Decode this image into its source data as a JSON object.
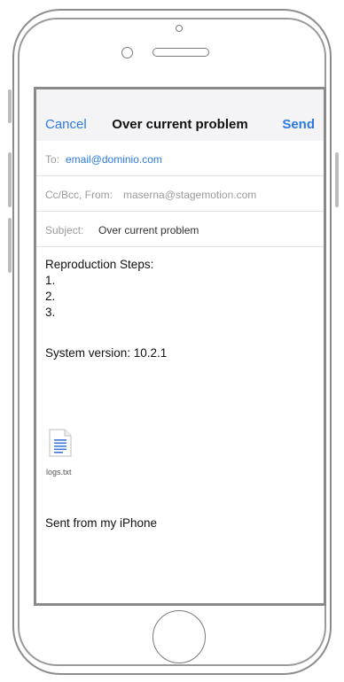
{
  "nav": {
    "cancel_label": "Cancel",
    "title": "Over current problem",
    "send_label": "Send"
  },
  "fields": {
    "to_label": "To:",
    "to_value": "email@dominio.com",
    "ccbcc_label": "Cc/Bcc, From:",
    "from_value": "maserna@stagemotion.com",
    "subject_label": "Subject:",
    "subject_value": "Over current problem"
  },
  "body": {
    "repro_title": "Reproduction Steps:",
    "steps": [
      "1.",
      "2.",
      "3."
    ],
    "system_version": "System version: 10.2.1",
    "attachment_name": "logs.txt",
    "signature": "Sent from my iPhone"
  },
  "colors": {
    "accent": "#2a7ae2",
    "frame": "#8a8a8a",
    "nav_bg": "#f4f4f6"
  },
  "icons": {
    "attachment": "text-file-icon"
  }
}
